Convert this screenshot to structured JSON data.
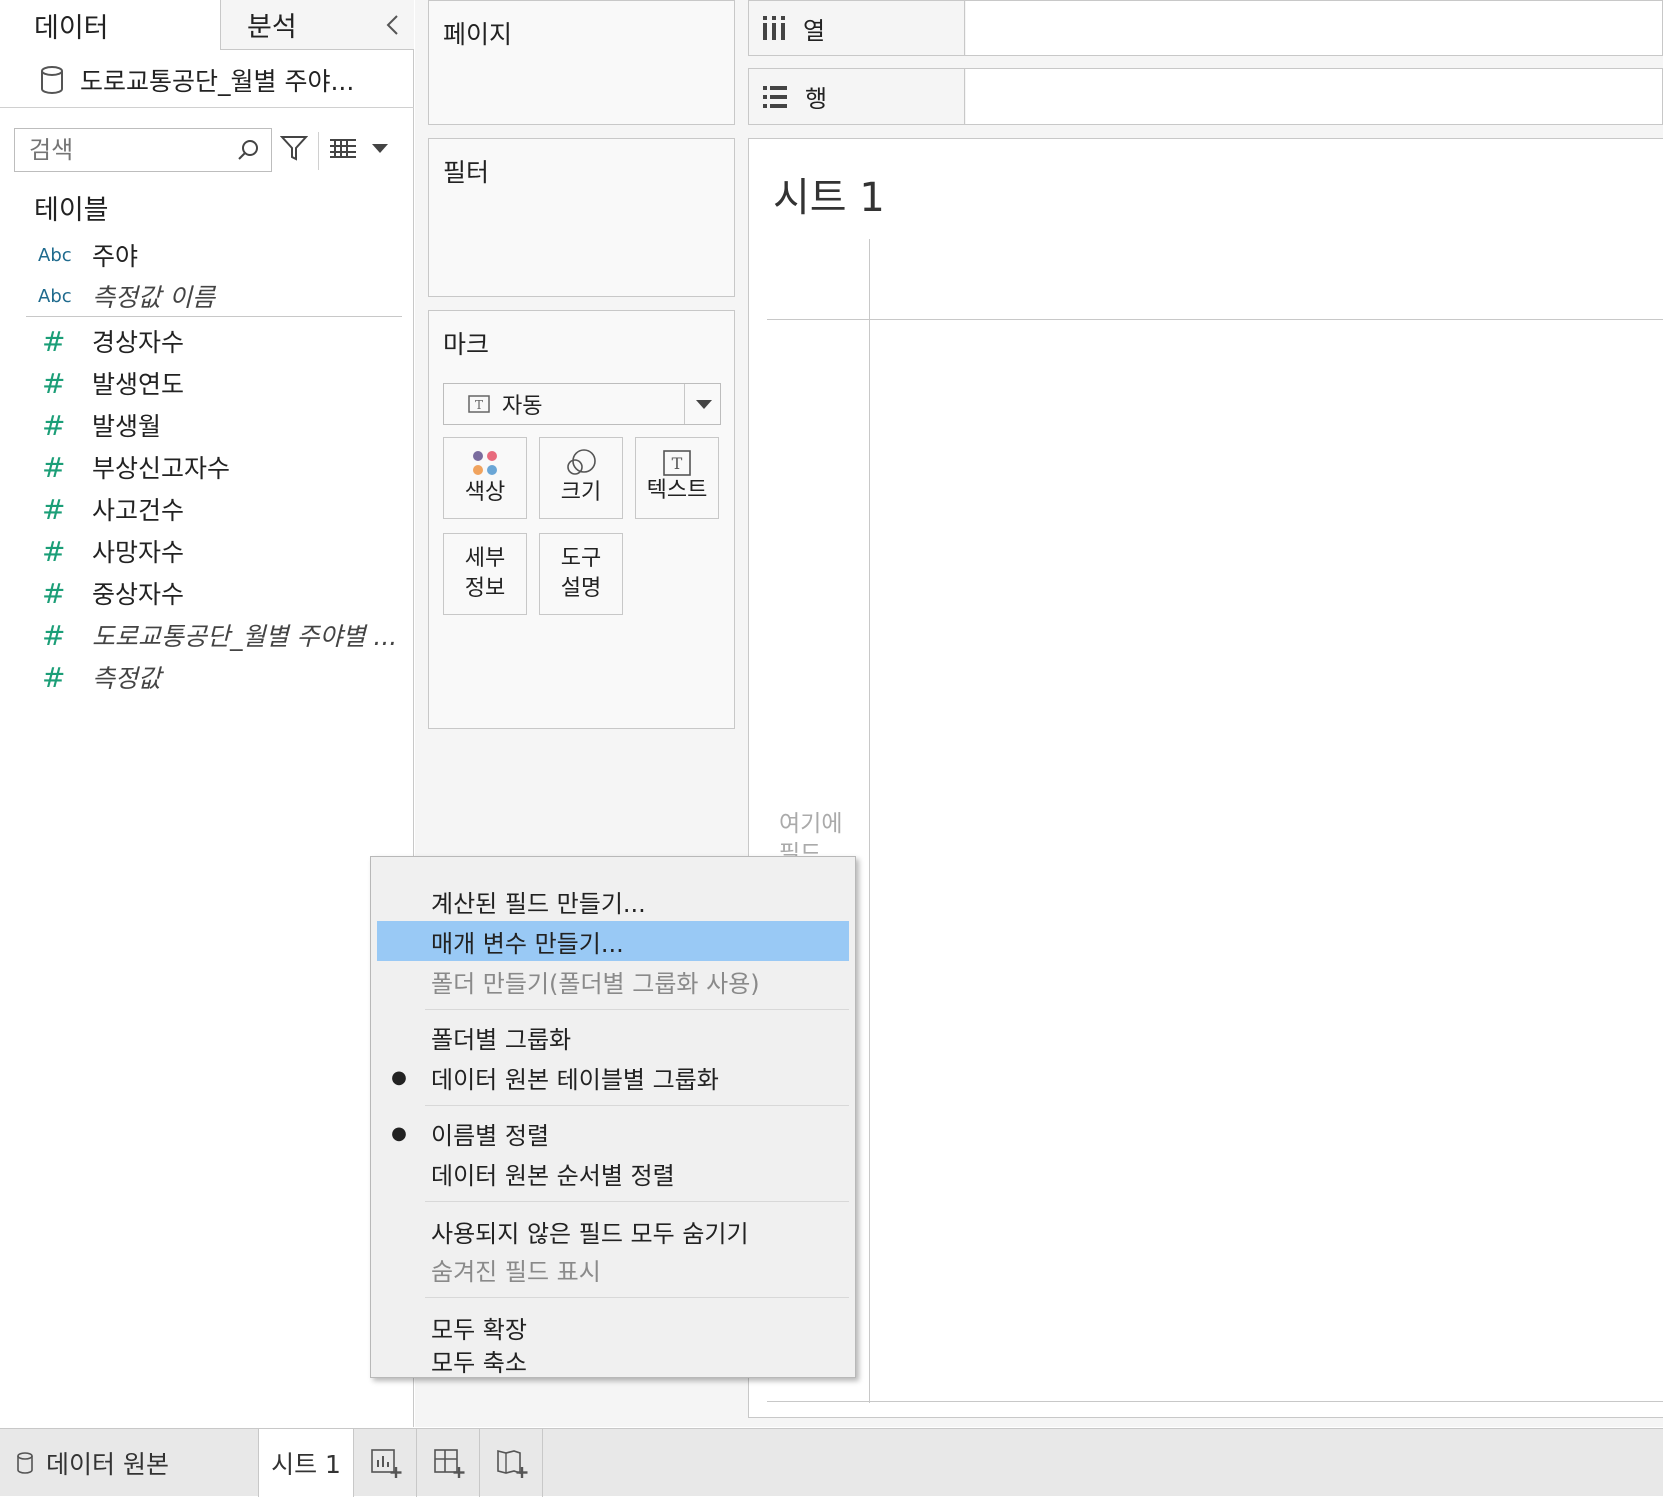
{
  "left_pane": {
    "tabs": {
      "data": "데이터",
      "analysis": "분석"
    },
    "datasource": "도로교통공단_월별 주야...",
    "search": {
      "placeholder": "검색"
    },
    "tables_heading": "테이블",
    "dimensions": [
      {
        "type": "Abc",
        "name": "주야",
        "italic": false
      },
      {
        "type": "Abc",
        "name": "측정값 이름",
        "italic": true
      }
    ],
    "measures": [
      {
        "type": "#",
        "name": "경상자수",
        "italic": false
      },
      {
        "type": "#",
        "name": "발생연도",
        "italic": false
      },
      {
        "type": "#",
        "name": "발생월",
        "italic": false
      },
      {
        "type": "#",
        "name": "부상신고자수",
        "italic": false
      },
      {
        "type": "#",
        "name": "사고건수",
        "italic": false
      },
      {
        "type": "#",
        "name": "사망자수",
        "italic": false
      },
      {
        "type": "#",
        "name": "중상자수",
        "italic": false
      },
      {
        "type": "#",
        "name": "도로교통공단_월별 주야별 ...",
        "italic": true
      },
      {
        "type": "#",
        "name": "측정값",
        "italic": true
      }
    ]
  },
  "cards": {
    "pages": "페이지",
    "filters": "필터",
    "marks": {
      "title": "마크",
      "type": "자동",
      "buttons": {
        "color": "색상",
        "size": "크기",
        "text": "텍스트",
        "detail": [
          "세부",
          "정보"
        ],
        "tooltip": [
          "도구",
          "설명"
        ]
      }
    }
  },
  "shelves": {
    "columns": "열",
    "rows": "행"
  },
  "sheet": {
    "title": "시트 1",
    "drop_hint": "여기에 필드"
  },
  "context_menu": {
    "items": [
      {
        "label": "계산된 필드 만들기...",
        "bullet": false,
        "highlighted": false,
        "disabled": false
      },
      {
        "label": "매개 변수 만들기...",
        "bullet": false,
        "highlighted": true,
        "disabled": false
      },
      {
        "label": "폴더 만들기(폴더별 그룹화 사용)",
        "bullet": false,
        "highlighted": false,
        "disabled": true
      },
      {
        "label": "폴더별 그룹화",
        "bullet": false,
        "highlighted": false,
        "disabled": false
      },
      {
        "label": "데이터 원본 테이블별 그룹화",
        "bullet": true,
        "highlighted": false,
        "disabled": false
      },
      {
        "label": "이름별 정렬",
        "bullet": true,
        "highlighted": false,
        "disabled": false
      },
      {
        "label": "데이터 원본 순서별 정렬",
        "bullet": false,
        "highlighted": false,
        "disabled": false
      },
      {
        "label": "사용되지 않은 필드 모두 숨기기",
        "bullet": false,
        "highlighted": false,
        "disabled": false
      },
      {
        "label": "숨겨진 필드 표시",
        "bullet": false,
        "highlighted": false,
        "disabled": true
      },
      {
        "label": "모두 확장",
        "bullet": false,
        "highlighted": false,
        "disabled": false
      },
      {
        "label": "모두 축소",
        "bullet": false,
        "highlighted": false,
        "disabled": false
      }
    ]
  },
  "bottom_bar": {
    "datasource_tab": "데이터 원본",
    "sheet_tab": "시트 1"
  },
  "colors": {
    "highlight": "#99c9f5",
    "measure_icon": "#1b9e77",
    "dimension_icon": "#1f6b8e"
  },
  "icons": [
    "database-icon",
    "collapse-icon",
    "search-icon",
    "filter-icon",
    "view-list-icon",
    "dropdown-icon",
    "text-mark-icon",
    "color-icon",
    "size-icon",
    "columns-icon",
    "rows-icon",
    "new-worksheet-icon",
    "new-dashboard-icon",
    "new-story-icon"
  ]
}
